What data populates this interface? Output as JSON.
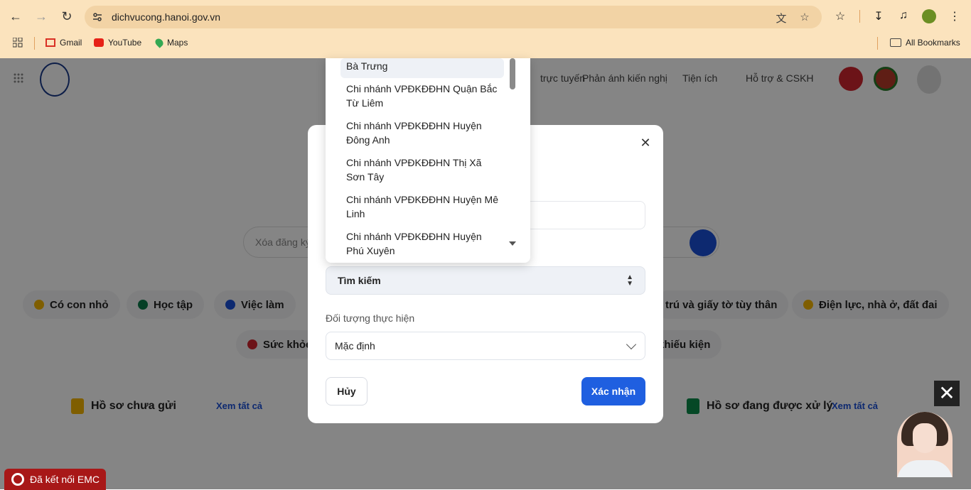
{
  "browser": {
    "url": "dichvucong.hanoi.gov.vn",
    "bookmarks": [
      "Gmail",
      "YouTube",
      "Maps"
    ],
    "all_bookmarks": "All Bookmarks"
  },
  "site": {
    "menu": [
      "trực tuyến",
      "Phản ánh kiến nghị",
      "Tiện ích",
      "Hỗ trợ & CSKH"
    ],
    "search_placeholder": "Xóa đăng ký",
    "chips": [
      "Có con nhỏ",
      "Học tập",
      "Việc làm",
      "trú và giấy tờ tùy thân",
      "Điện lực, nhà ở, đất đai",
      "Sức khỏe",
      "khiếu kiện"
    ],
    "card_left_title": "Hồ sơ chưa gửi",
    "card_right_title": "Hồ sơ đang được xử lý",
    "see_all": "Xem tất cả"
  },
  "modal": {
    "search_select_value": "Tìm kiếm",
    "subject_label": "Đối tượng thực hiện",
    "subject_value": "Mặc định",
    "cancel_label": "Hủy",
    "confirm_label": "Xác nhận"
  },
  "dropdown": {
    "items": [
      "Bà Trưng",
      "Chi nhánh VPĐKĐĐHN Quận Bắc Từ Liêm",
      "Chi nhánh VPĐKĐĐHN Huyện Đông Anh",
      "Chi nhánh VPĐKĐĐHN Thị Xã Sơn Tây",
      "Chi nhánh VPĐKĐĐHN Huyện Mê Linh",
      "Chi nhánh VPĐKĐĐHN Huyện Phú Xuyên"
    ]
  },
  "widgets": {
    "emc_label": "Đã kết nối EMC"
  }
}
